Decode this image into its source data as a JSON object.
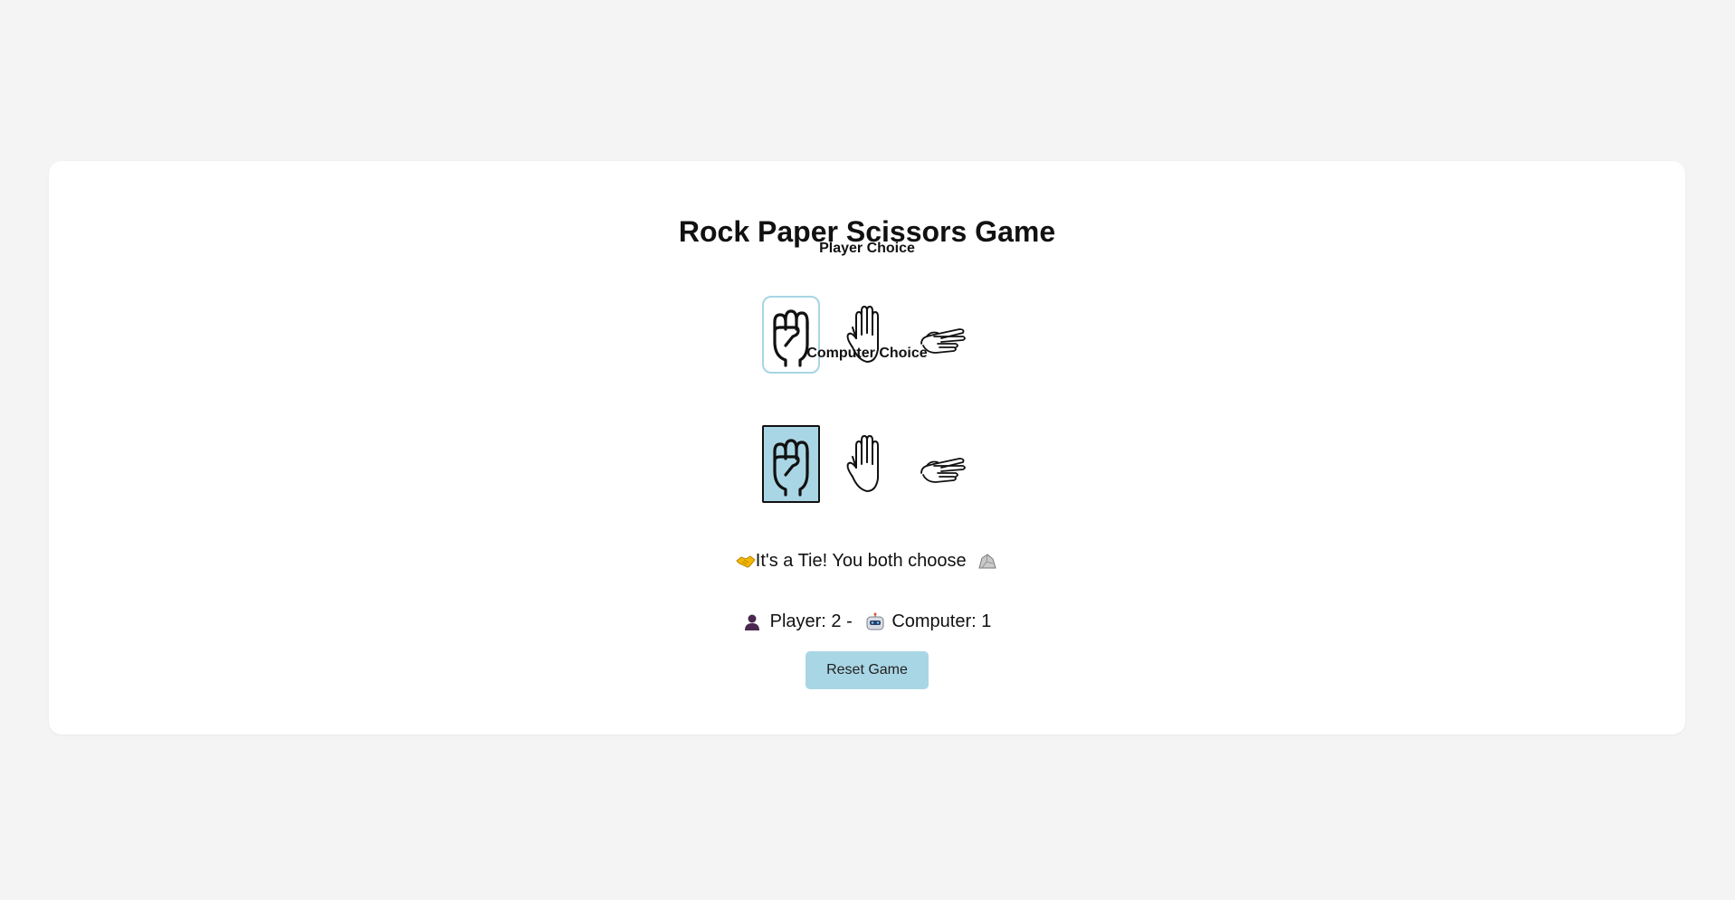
{
  "game": {
    "title": "Rock Paper Scissors Game",
    "player_label": "Player Choice",
    "computer_label": "Computer Choice",
    "choices": [
      {
        "name": "rock",
        "icon": "fist-icon"
      },
      {
        "name": "paper",
        "icon": "open-hand-icon"
      },
      {
        "name": "scissors",
        "icon": "victory-hand-icon"
      }
    ],
    "player_selected": "rock",
    "computer_selected": "rock",
    "result_text": "It's a Tie! You both choose",
    "result_icon": "handshake-icon",
    "result_choice_icon": "rock-icon",
    "score": {
      "player_label": "Player: 2 -",
      "computer_label": "Computer: 1",
      "player_icon": "user-icon",
      "computer_icon": "robot-icon"
    },
    "reset_label": "Reset Game",
    "accent_color": "#a9d6e5"
  }
}
